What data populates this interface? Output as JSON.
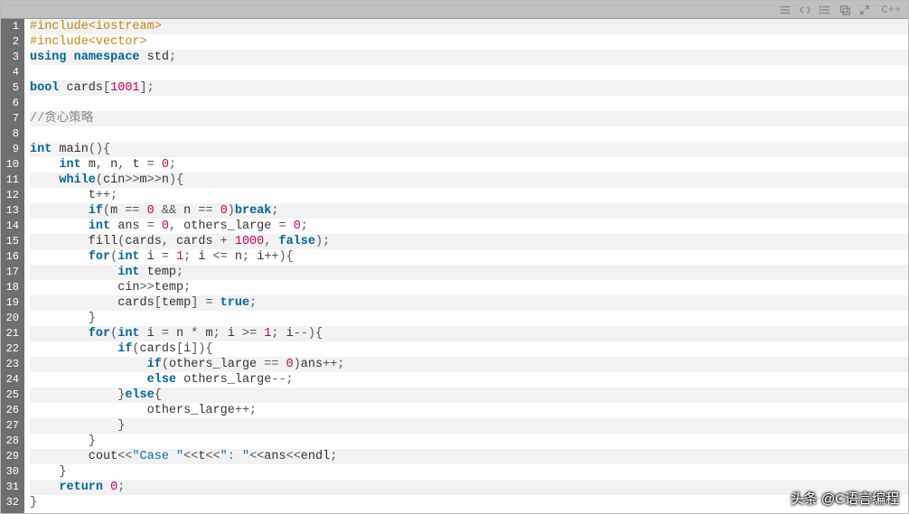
{
  "toolbar": {
    "language": "C++",
    "icons": [
      "menu-icon",
      "code-icon",
      "list-icon",
      "copy-icon",
      "expand-icon"
    ]
  },
  "code": {
    "lines": [
      [
        [
          "preproc",
          "#include<iostream>"
        ]
      ],
      [
        [
          "preproc",
          "#include<vector>"
        ]
      ],
      [
        [
          "keyword",
          "using"
        ],
        [
          "ident",
          " "
        ],
        [
          "keyword",
          "namespace"
        ],
        [
          "ident",
          " std"
        ],
        [
          "punct",
          ";"
        ]
      ],
      [],
      [
        [
          "keyword",
          "bool"
        ],
        [
          "ident",
          " cards"
        ],
        [
          "punct",
          "["
        ],
        [
          "number",
          "1001"
        ],
        [
          "punct",
          "];"
        ]
      ],
      [],
      [
        [
          "comment",
          "//贪心策略"
        ]
      ],
      [],
      [
        [
          "keyword",
          "int"
        ],
        [
          "ident",
          " main"
        ],
        [
          "punct",
          "(){"
        ]
      ],
      [
        [
          "ident",
          "    "
        ],
        [
          "keyword",
          "int"
        ],
        [
          "ident",
          " m"
        ],
        [
          "punct",
          ", "
        ],
        [
          "ident",
          "n"
        ],
        [
          "punct",
          ", "
        ],
        [
          "ident",
          "t "
        ],
        [
          "punct",
          "= "
        ],
        [
          "number",
          "0"
        ],
        [
          "punct",
          ";"
        ]
      ],
      [
        [
          "ident",
          "    "
        ],
        [
          "keyword",
          "while"
        ],
        [
          "punct",
          "("
        ],
        [
          "ident",
          "cin"
        ],
        [
          "punct",
          ">>"
        ],
        [
          "ident",
          "m"
        ],
        [
          "punct",
          ">>"
        ],
        [
          "ident",
          "n"
        ],
        [
          "punct",
          "){"
        ]
      ],
      [
        [
          "ident",
          "        t"
        ],
        [
          "punct",
          "++;"
        ]
      ],
      [
        [
          "ident",
          "        "
        ],
        [
          "keyword",
          "if"
        ],
        [
          "punct",
          "("
        ],
        [
          "ident",
          "m "
        ],
        [
          "punct",
          "== "
        ],
        [
          "number",
          "0"
        ],
        [
          "ident",
          " "
        ],
        [
          "punct",
          "&& "
        ],
        [
          "ident",
          "n "
        ],
        [
          "punct",
          "== "
        ],
        [
          "number",
          "0"
        ],
        [
          "punct",
          ")"
        ],
        [
          "keyword",
          "break"
        ],
        [
          "punct",
          ";"
        ]
      ],
      [
        [
          "ident",
          "        "
        ],
        [
          "keyword",
          "int"
        ],
        [
          "ident",
          " ans "
        ],
        [
          "punct",
          "= "
        ],
        [
          "number",
          "0"
        ],
        [
          "punct",
          ", "
        ],
        [
          "ident",
          "others_large "
        ],
        [
          "punct",
          "= "
        ],
        [
          "number",
          "0"
        ],
        [
          "punct",
          ";"
        ]
      ],
      [
        [
          "ident",
          "        fill"
        ],
        [
          "punct",
          "("
        ],
        [
          "ident",
          "cards"
        ],
        [
          "punct",
          ", "
        ],
        [
          "ident",
          "cards "
        ],
        [
          "punct",
          "+ "
        ],
        [
          "number",
          "1000"
        ],
        [
          "punct",
          ", "
        ],
        [
          "bool",
          "false"
        ],
        [
          "punct",
          ");"
        ]
      ],
      [
        [
          "ident",
          "        "
        ],
        [
          "keyword",
          "for"
        ],
        [
          "punct",
          "("
        ],
        [
          "keyword",
          "int"
        ],
        [
          "ident",
          " i "
        ],
        [
          "punct",
          "= "
        ],
        [
          "number",
          "1"
        ],
        [
          "punct",
          "; "
        ],
        [
          "ident",
          "i "
        ],
        [
          "punct",
          "<= "
        ],
        [
          "ident",
          "n"
        ],
        [
          "punct",
          "; "
        ],
        [
          "ident",
          "i"
        ],
        [
          "punct",
          "++){"
        ]
      ],
      [
        [
          "ident",
          "            "
        ],
        [
          "keyword",
          "int"
        ],
        [
          "ident",
          " temp"
        ],
        [
          "punct",
          ";"
        ]
      ],
      [
        [
          "ident",
          "            cin"
        ],
        [
          "punct",
          ">>"
        ],
        [
          "ident",
          "temp"
        ],
        [
          "punct",
          ";"
        ]
      ],
      [
        [
          "ident",
          "            cards"
        ],
        [
          "punct",
          "["
        ],
        [
          "ident",
          "temp"
        ],
        [
          "punct",
          "] = "
        ],
        [
          "bool",
          "true"
        ],
        [
          "punct",
          ";"
        ]
      ],
      [
        [
          "ident",
          "        "
        ],
        [
          "punct",
          "}"
        ]
      ],
      [
        [
          "ident",
          "        "
        ],
        [
          "keyword",
          "for"
        ],
        [
          "punct",
          "("
        ],
        [
          "keyword",
          "int"
        ],
        [
          "ident",
          " i "
        ],
        [
          "punct",
          "= "
        ],
        [
          "ident",
          "n "
        ],
        [
          "punct",
          "* "
        ],
        [
          "ident",
          "m"
        ],
        [
          "punct",
          "; "
        ],
        [
          "ident",
          "i "
        ],
        [
          "punct",
          ">= "
        ],
        [
          "number",
          "1"
        ],
        [
          "punct",
          "; "
        ],
        [
          "ident",
          "i"
        ],
        [
          "punct",
          "--){"
        ]
      ],
      [
        [
          "ident",
          "            "
        ],
        [
          "keyword",
          "if"
        ],
        [
          "punct",
          "("
        ],
        [
          "ident",
          "cards"
        ],
        [
          "punct",
          "["
        ],
        [
          "ident",
          "i"
        ],
        [
          "punct",
          "]){"
        ]
      ],
      [
        [
          "ident",
          "                "
        ],
        [
          "keyword",
          "if"
        ],
        [
          "punct",
          "("
        ],
        [
          "ident",
          "others_large "
        ],
        [
          "punct",
          "== "
        ],
        [
          "number",
          "0"
        ],
        [
          "punct",
          ")"
        ],
        [
          "ident",
          "ans"
        ],
        [
          "punct",
          "++;"
        ]
      ],
      [
        [
          "ident",
          "                "
        ],
        [
          "keyword",
          "else"
        ],
        [
          "ident",
          " others_large"
        ],
        [
          "punct",
          "--;"
        ]
      ],
      [
        [
          "ident",
          "            "
        ],
        [
          "punct",
          "}"
        ],
        [
          "keyword",
          "else"
        ],
        [
          "punct",
          "{"
        ]
      ],
      [
        [
          "ident",
          "                others_large"
        ],
        [
          "punct",
          "++;"
        ]
      ],
      [
        [
          "ident",
          "            "
        ],
        [
          "punct",
          "}"
        ]
      ],
      [
        [
          "ident",
          "        "
        ],
        [
          "punct",
          "}"
        ]
      ],
      [
        [
          "ident",
          "        cout"
        ],
        [
          "punct",
          "<<"
        ],
        [
          "string",
          "\"Case \""
        ],
        [
          "punct",
          "<<"
        ],
        [
          "ident",
          "t"
        ],
        [
          "punct",
          "<<"
        ],
        [
          "string",
          "\": \""
        ],
        [
          "punct",
          "<<"
        ],
        [
          "ident",
          "ans"
        ],
        [
          "punct",
          "<<"
        ],
        [
          "ident",
          "endl"
        ],
        [
          "punct",
          ";"
        ]
      ],
      [
        [
          "ident",
          "    "
        ],
        [
          "punct",
          "}"
        ]
      ],
      [
        [
          "ident",
          "    "
        ],
        [
          "keyword",
          "return"
        ],
        [
          "ident",
          " "
        ],
        [
          "number",
          "0"
        ],
        [
          "punct",
          ";"
        ]
      ],
      [
        [
          "punct",
          "}"
        ]
      ]
    ]
  },
  "watermark": "头条 @C语言编程"
}
